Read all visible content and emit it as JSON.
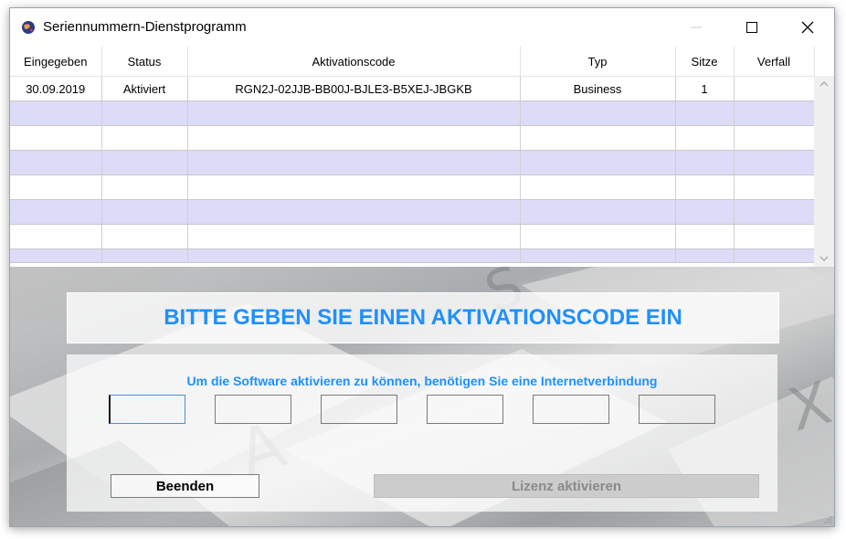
{
  "window": {
    "title": "Seriennummern-Dienstprogramm",
    "icon": "app-globe-icon",
    "controls": {
      "minimize": "minimize-icon",
      "maximize": "maximize-icon",
      "close": "close-icon"
    }
  },
  "grid": {
    "columns": [
      "Eingegeben",
      "Status",
      "Aktivationscode",
      "Typ",
      "Sitze",
      "Verfall"
    ],
    "rows": [
      [
        "30.09.2019",
        "Aktiviert",
        "RGN2J-02JJB-BB00J-BJLE3-B5XEJ-JBGKB",
        "Business",
        "1",
        ""
      ],
      [
        "",
        "",
        "",
        "",
        "",
        ""
      ],
      [
        "",
        "",
        "",
        "",
        "",
        ""
      ],
      [
        "",
        "",
        "",
        "",
        "",
        ""
      ],
      [
        "",
        "",
        "",
        "",
        "",
        ""
      ],
      [
        "",
        "",
        "",
        "",
        "",
        ""
      ],
      [
        "",
        "",
        "",
        "",
        "",
        ""
      ],
      [
        "",
        "",
        "",
        "",
        "",
        ""
      ]
    ],
    "alt_row_color": "#dcdcf8"
  },
  "activation": {
    "heading": "BITTE GEBEN SIE EINEN AKTIVATIONSCODE EIN",
    "hint": "Um die Software aktivieren zu können, benötigen Sie eine Internetverbindung",
    "code_fields": [
      "",
      "",
      "",
      "",
      "",
      ""
    ],
    "quit_label": "Beenden",
    "activate_label": "Lizenz aktivieren",
    "accent_color": "#1e90ff"
  }
}
